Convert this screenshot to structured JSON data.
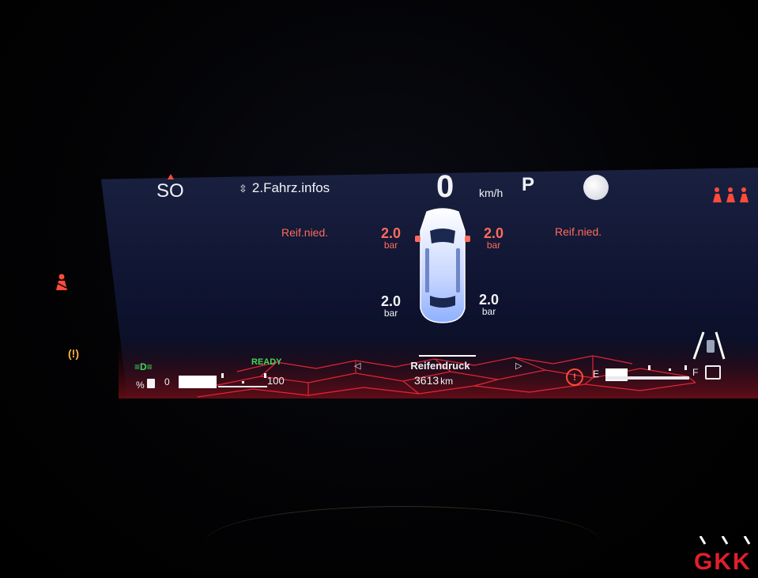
{
  "top_bar": {
    "compass": "SO",
    "info_title": "2.Fahrz.infos",
    "speed": "0",
    "speed_unit": "km/h",
    "gear": "P"
  },
  "tires": {
    "front_left": {
      "value": "2.0",
      "unit": "bar",
      "status": "Reif.nied."
    },
    "front_right": {
      "value": "2.0",
      "unit": "bar",
      "status": "Reif.nied."
    },
    "rear_left": {
      "value": "2.0",
      "unit": "bar"
    },
    "rear_right": {
      "value": "2.0",
      "unit": "bar"
    }
  },
  "bottom_bar": {
    "ready_label": "READY",
    "screen_title": "Reifendruck",
    "odometer": "3613",
    "odometer_unit": "km",
    "battery_label": "%",
    "battery_scale_min": "0",
    "battery_scale_max": "100",
    "fuel_empty_label": "E",
    "fuel_full_label": "F"
  },
  "watermark": {
    "text": "GKK"
  },
  "colors": {
    "warning_red": "#ff6b5c",
    "ready_green": "#3fd95a",
    "tpms_amber": "#ffb340",
    "text_white": "#f2f2f6"
  },
  "icons": [
    "compass-arrow-icon",
    "up-down-arrow-icon",
    "moon-icon",
    "seatbelt-warning-icon",
    "tpms-warning-icon",
    "headlight-icon",
    "battery-icon",
    "brake-warning-icon",
    "fuel-pump-icon",
    "lane-assist-icon",
    "arrow-left-icon",
    "arrow-right-icon"
  ]
}
